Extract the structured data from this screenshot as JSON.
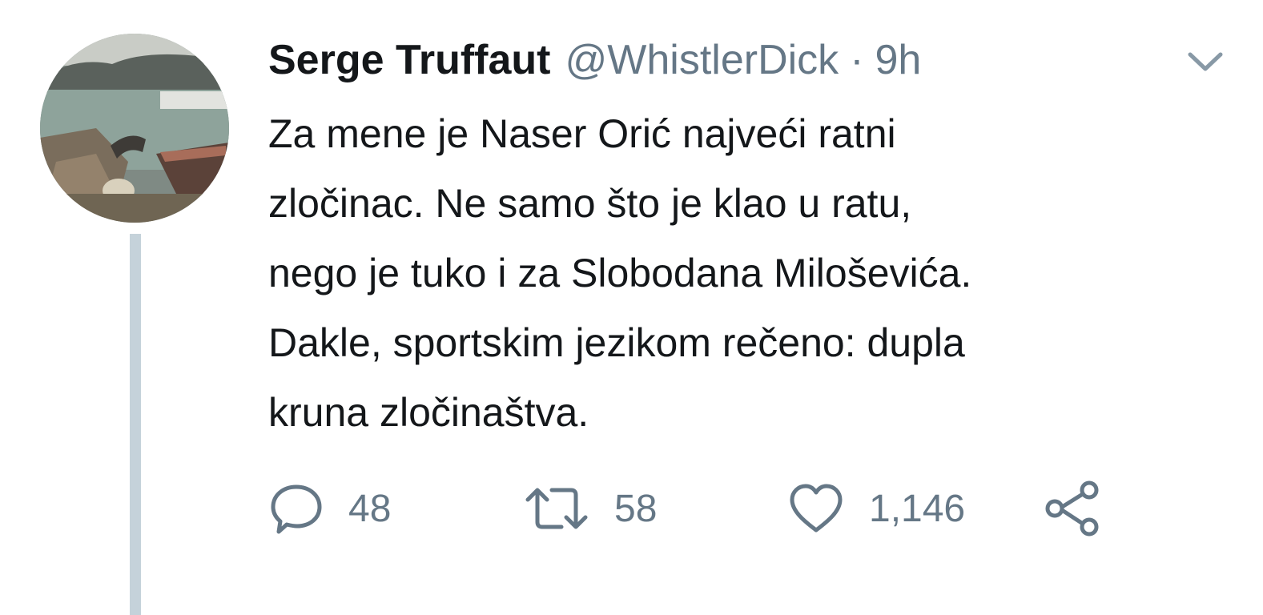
{
  "tweet": {
    "author_name": "Serge Truffaut",
    "handle": "@WhistlerDick",
    "separator": "·",
    "time": "9h",
    "text_lines": [
      "Za mene je Naser Orić najveći ratni",
      "zločinac. Ne samo što je klao u ratu,",
      "nego je tuko i za Slobodana Miloševića.",
      "Dakle, sportskim jezikom rečeno: dupla",
      "kruna zločinaštva."
    ]
  },
  "actions": {
    "reply": {
      "icon": "reply-icon",
      "count": "48"
    },
    "retweet": {
      "icon": "retweet-icon",
      "count": "58"
    },
    "like": {
      "icon": "heart-icon",
      "count": "1,146"
    },
    "share": {
      "icon": "share-icon"
    }
  },
  "icons": {
    "avatar": "avatar",
    "menu": "chevron-down-icon"
  },
  "colors": {
    "text": "#14171a",
    "secondary": "#657786",
    "thread_line": "#c5d2da"
  }
}
